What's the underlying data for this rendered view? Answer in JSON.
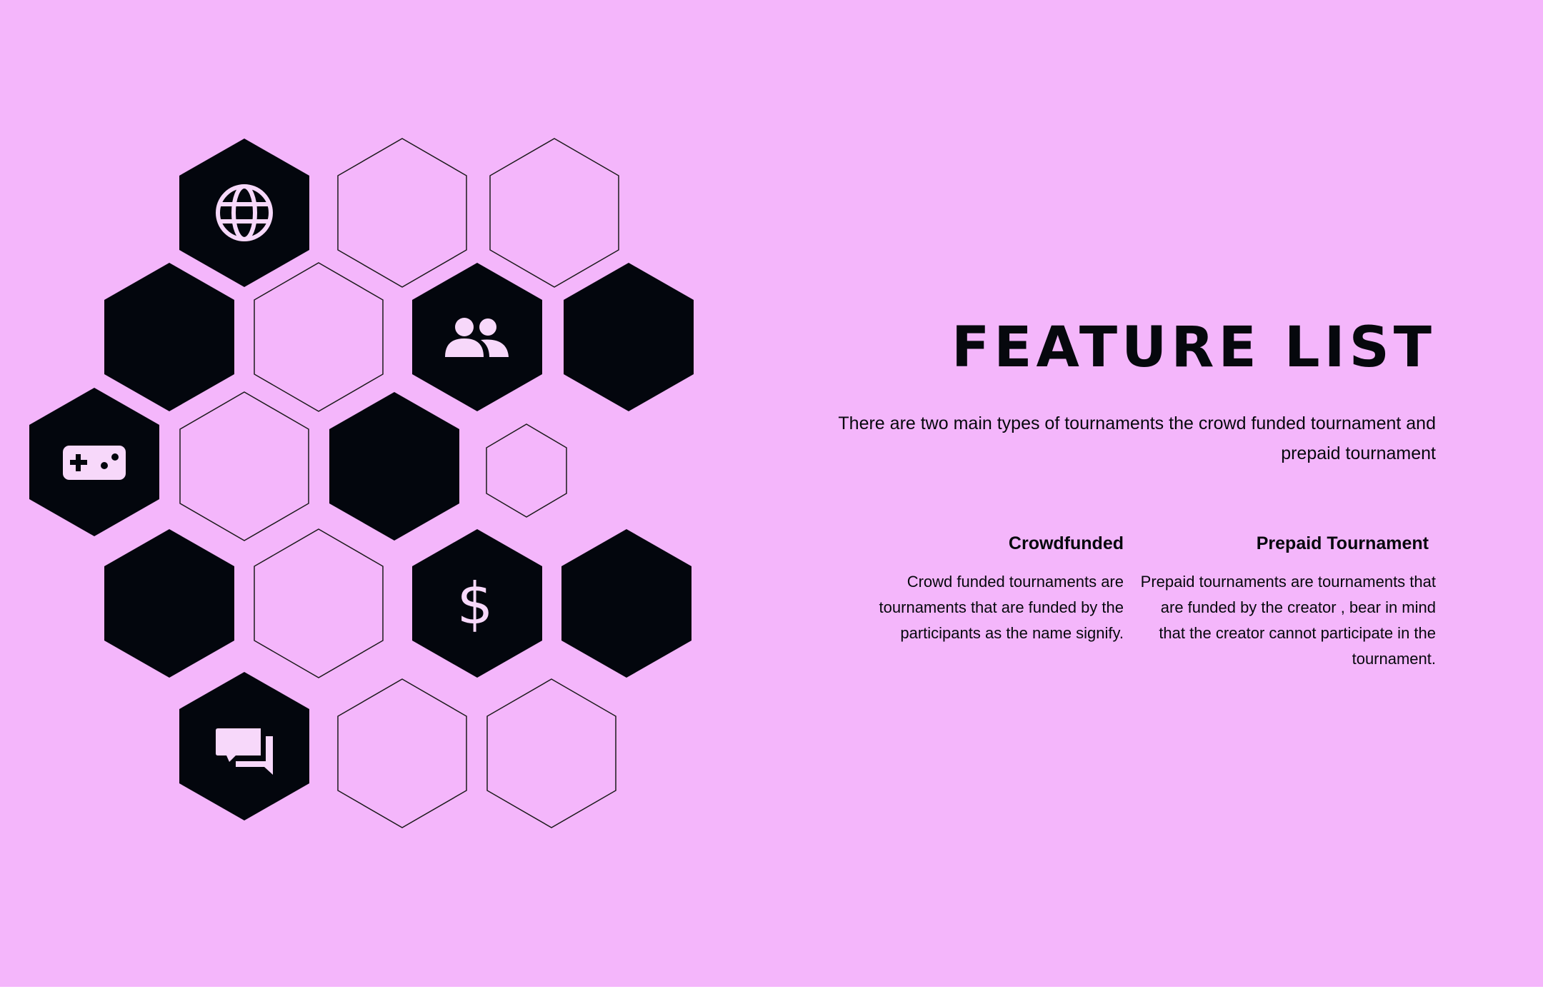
{
  "slide": {
    "title": "FEATURE LIST",
    "intro": "There are two main types of tournaments the crowd funded tournament and prepaid tournament",
    "features": [
      {
        "heading": "Crowdfunded",
        "body": "Crowd funded tournaments are tournaments that are funded by the participants as the name signify."
      },
      {
        "heading": "Prepaid Tournament",
        "body": "Prepaid tournaments are tournaments that are funded by the creator , bear in mind that the creator cannot participate in the tournament."
      }
    ]
  },
  "icons": [
    "globe-icon",
    "users-icon",
    "gamepad-icon",
    "dollar-icon",
    "chat-icon"
  ],
  "colors": {
    "background": "#f4b6fb",
    "hex_fill": "#03060d",
    "icon_fill": "#f7d8fa",
    "outline": "#1a1a1a"
  }
}
